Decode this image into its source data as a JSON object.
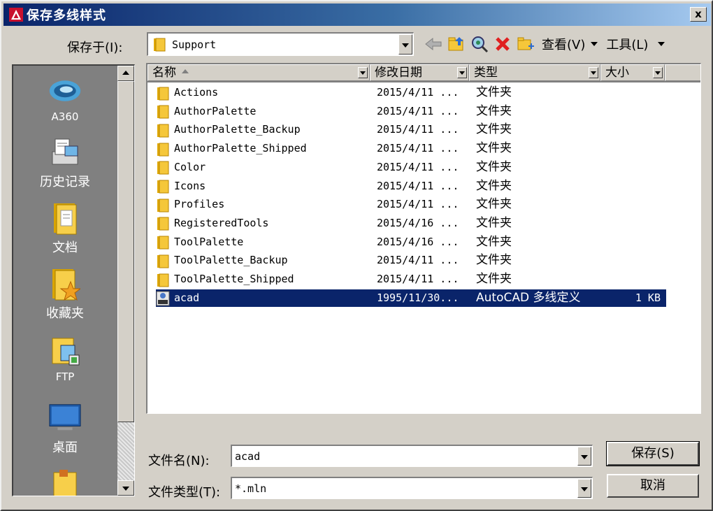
{
  "window": {
    "title": "保存多线样式",
    "close_label": "x"
  },
  "save_in": {
    "label": "保存于(I):",
    "value": "Support"
  },
  "toolbar": {
    "view_label": "查看(V)",
    "tools_label": "工具(L)"
  },
  "places": [
    {
      "label": "A360",
      "icon": "a360-cloud-icon"
    },
    {
      "label": "历史记录",
      "icon": "history-icon"
    },
    {
      "label": "文档",
      "icon": "documents-folder-icon"
    },
    {
      "label": "收藏夹",
      "icon": "favorites-folder-icon"
    },
    {
      "label": "FTP",
      "icon": "ftp-icon"
    },
    {
      "label": "桌面",
      "icon": "desktop-monitor-icon"
    }
  ],
  "columns": {
    "name": "名称",
    "modified": "修改日期",
    "type": "类型",
    "size": "大小"
  },
  "files": [
    {
      "name": "Actions",
      "modified": "2015/4/11 ...",
      "type": "文件夹",
      "size": "",
      "kind": "folder"
    },
    {
      "name": "AuthorPalette",
      "modified": "2015/4/11 ...",
      "type": "文件夹",
      "size": "",
      "kind": "folder"
    },
    {
      "name": "AuthorPalette_Backup",
      "modified": "2015/4/11 ...",
      "type": "文件夹",
      "size": "",
      "kind": "folder"
    },
    {
      "name": "AuthorPalette_Shipped",
      "modified": "2015/4/11 ...",
      "type": "文件夹",
      "size": "",
      "kind": "folder"
    },
    {
      "name": "Color",
      "modified": "2015/4/11 ...",
      "type": "文件夹",
      "size": "",
      "kind": "folder"
    },
    {
      "name": "Icons",
      "modified": "2015/4/11 ...",
      "type": "文件夹",
      "size": "",
      "kind": "folder"
    },
    {
      "name": "Profiles",
      "modified": "2015/4/11 ...",
      "type": "文件夹",
      "size": "",
      "kind": "folder"
    },
    {
      "name": "RegisteredTools",
      "modified": "2015/4/16 ...",
      "type": "文件夹",
      "size": "",
      "kind": "folder"
    },
    {
      "name": "ToolPalette",
      "modified": "2015/4/16 ...",
      "type": "文件夹",
      "size": "",
      "kind": "folder"
    },
    {
      "name": "ToolPalette_Backup",
      "modified": "2015/4/11 ...",
      "type": "文件夹",
      "size": "",
      "kind": "folder"
    },
    {
      "name": "ToolPalette_Shipped",
      "modified": "2015/4/11 ...",
      "type": "文件夹",
      "size": "",
      "kind": "folder"
    },
    {
      "name": "acad",
      "modified": "1995/11/30...",
      "type": "AutoCAD 多线定义",
      "size": "1 KB",
      "kind": "mln",
      "selected": true
    }
  ],
  "filename": {
    "label": "文件名(N):",
    "value": "acad"
  },
  "filetype": {
    "label": "文件类型(T):",
    "value": "*.mln"
  },
  "buttons": {
    "save": "保存(S)",
    "cancel": "取消"
  },
  "colors": {
    "selection": "#0a246a",
    "title_start": "#0a246a",
    "title_end": "#a6caf0",
    "face": "#d4d0c8"
  }
}
